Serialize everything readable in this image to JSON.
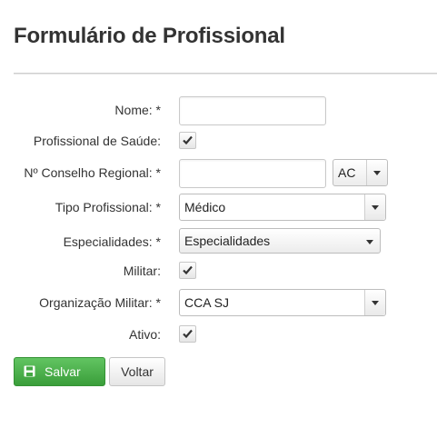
{
  "page": {
    "title": "Formulário de Profissional"
  },
  "form": {
    "nome": {
      "label": "Nome: *",
      "value": ""
    },
    "profissional_saude": {
      "label": "Profissional de Saúde:",
      "checked": true
    },
    "conselho": {
      "label": "Nº Conselho Regional: *",
      "value": "",
      "uf": "AC"
    },
    "tipo": {
      "label": "Tipo Profissional: *",
      "value": "Médico"
    },
    "especialidades": {
      "label": "Especialidades: *",
      "value": "Especialidades"
    },
    "militar": {
      "label": "Militar:",
      "checked": true
    },
    "organizacao": {
      "label": "Organização Militar: *",
      "value": "CCA SJ"
    },
    "ativo": {
      "label": "Ativo:",
      "checked": true
    }
  },
  "buttons": {
    "save": "Salvar",
    "back": "Voltar"
  },
  "colors": {
    "save_button": "#4cae4c",
    "text": "#333333"
  },
  "icons": {
    "save": "floppy-disk-icon",
    "check": "checkmark-icon",
    "dropdown": "caret-down-icon"
  }
}
